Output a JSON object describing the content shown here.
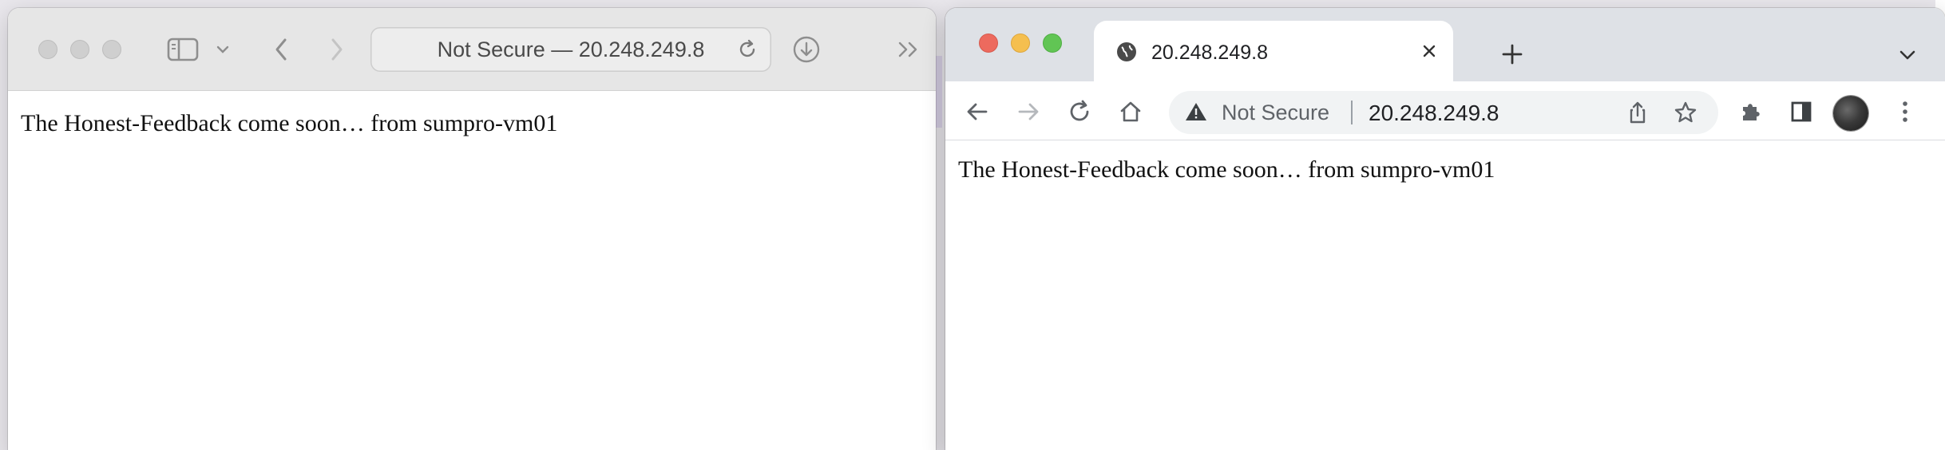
{
  "safari": {
    "address": "Not Secure — 20.248.249.8",
    "content_text": "The Honest-Feedback come soon… from sumpro-vm01"
  },
  "chrome": {
    "tab_title": "20.248.249.8",
    "omnibox": {
      "security_label": "Not Secure",
      "url": "20.248.249.8"
    },
    "content_text": "The Honest-Feedback come soon… from sumpro-vm01"
  },
  "icons": {
    "safari": [
      "sidebar-icon",
      "chevron-down-icon",
      "back-icon",
      "forward-icon",
      "reload-icon",
      "download-icon",
      "more-icon"
    ],
    "chrome": [
      "globe-icon",
      "close-icon",
      "plus-icon",
      "chevron-down-icon",
      "back-icon",
      "forward-icon",
      "reload-icon",
      "home-icon",
      "warning-icon",
      "share-icon",
      "star-icon",
      "puzzle-icon",
      "side-panel-icon",
      "more-vertical-icon"
    ]
  },
  "colors": {
    "close": "#ed6a5e",
    "minimize": "#f5bf4f",
    "zoom": "#61c554"
  }
}
